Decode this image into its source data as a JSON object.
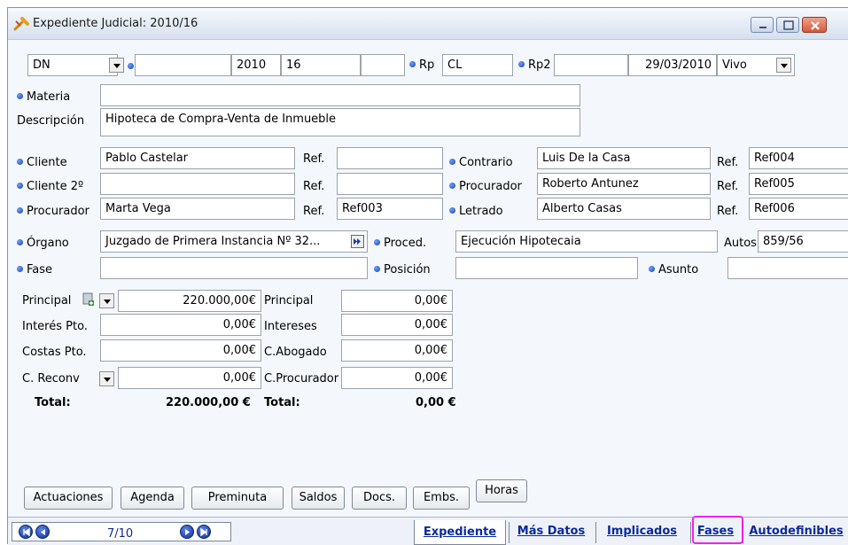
{
  "window": {
    "title": "Expediente Judicial: 2010/16"
  },
  "header_row": {
    "type_value": "DN",
    "blank1": "",
    "year": "2010",
    "number": "16",
    "blank2": "",
    "rp_label": "Rp",
    "rp_value": "CL",
    "rp2_label": "Rp2",
    "rp2_value": "",
    "date": "29/03/2010",
    "status_value": "Vivo"
  },
  "materia": {
    "label": "Materia",
    "value": ""
  },
  "descripcion": {
    "label": "Descripción",
    "value": "Hipoteca de Compra-Venta de Inmueble"
  },
  "parties_left": [
    {
      "label": "Cliente",
      "value": "Pablo Castelar",
      "ref_label": "Ref.",
      "ref": ""
    },
    {
      "label": "Cliente 2º",
      "value": "",
      "ref_label": "Ref.",
      "ref": ""
    },
    {
      "label": "Procurador",
      "value": "Marta Vega",
      "ref_label": "Ref.",
      "ref": "Ref003"
    }
  ],
  "parties_right": [
    {
      "label": "Contrario",
      "value": "Luis De la Casa",
      "ref_label": "Ref.",
      "ref": "Ref004"
    },
    {
      "label": "Procurador",
      "value": "Roberto Antunez",
      "ref_label": "Ref.",
      "ref": "Ref005"
    },
    {
      "label": "Letrado",
      "value": "Alberto Casas",
      "ref_label": "Ref.",
      "ref": "Ref006"
    }
  ],
  "organo": {
    "label": "Órgano",
    "value": "Juzgado de Primera Instancia Nº 32..."
  },
  "proced": {
    "label": "Proced.",
    "value": "Ejecución Hipotecaia"
  },
  "autos": {
    "label": "Autos",
    "value": "859/56"
  },
  "fase": {
    "label": "Fase",
    "value": ""
  },
  "posicion": {
    "label": "Posición",
    "value": ""
  },
  "asunto": {
    "label": "Asunto",
    "value": ""
  },
  "amounts_left": [
    {
      "label": "Principal",
      "value": "220.000,00€"
    },
    {
      "label": "Interés Pto.",
      "value": "0,00€"
    },
    {
      "label": "Costas Pto.",
      "value": "0,00€"
    },
    {
      "label": "C. Reconv",
      "value": "0,00€"
    }
  ],
  "amounts_right": [
    {
      "label": "Principal",
      "value": "0,00€"
    },
    {
      "label": "Intereses",
      "value": "0,00€"
    },
    {
      "label": "C.Abogado",
      "value": "0,00€"
    },
    {
      "label": "C.Procurador",
      "value": "0,00€"
    }
  ],
  "totals": {
    "label_left": "Total:",
    "value_left": "220.000,00 €",
    "label_right": "Total:",
    "value_right": "0,00 €"
  },
  "buttons": [
    "Actuaciones",
    "Agenda",
    "Preminuta",
    "Saldos",
    "Docs.",
    "Embs.",
    "Horas"
  ],
  "navigator": {
    "position": "7/10"
  },
  "tabs": [
    "Expediente",
    "Más Datos",
    "Implicados",
    "Fases",
    "Autodefinibles"
  ],
  "colors": {
    "highlight": "#ee22ee",
    "tab_text": "#0a2a9a",
    "title_bar": "#e4ebf5"
  }
}
